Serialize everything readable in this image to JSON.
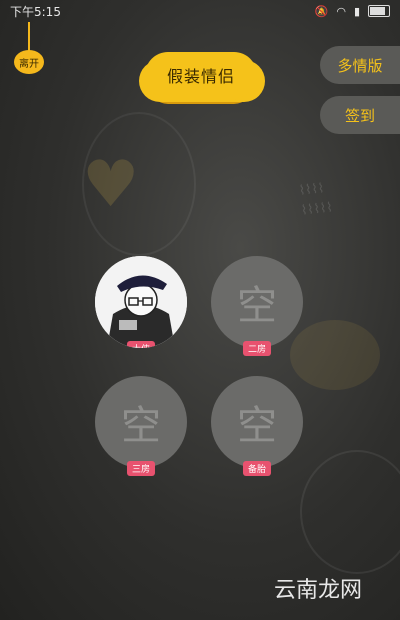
{
  "statusbar": {
    "time": "下午5:15"
  },
  "leave": {
    "label": "离开"
  },
  "title": {
    "text": "假装情侣"
  },
  "buttons": {
    "multi": "多情版",
    "signin": "签到"
  },
  "slots": [
    {
      "label": "大侠",
      "empty_char": ""
    },
    {
      "label": "二房",
      "empty_char": "空"
    },
    {
      "label": "三房",
      "empty_char": "空"
    },
    {
      "label": "备胎",
      "empty_char": "空"
    }
  ],
  "watermark": "云南龙网"
}
